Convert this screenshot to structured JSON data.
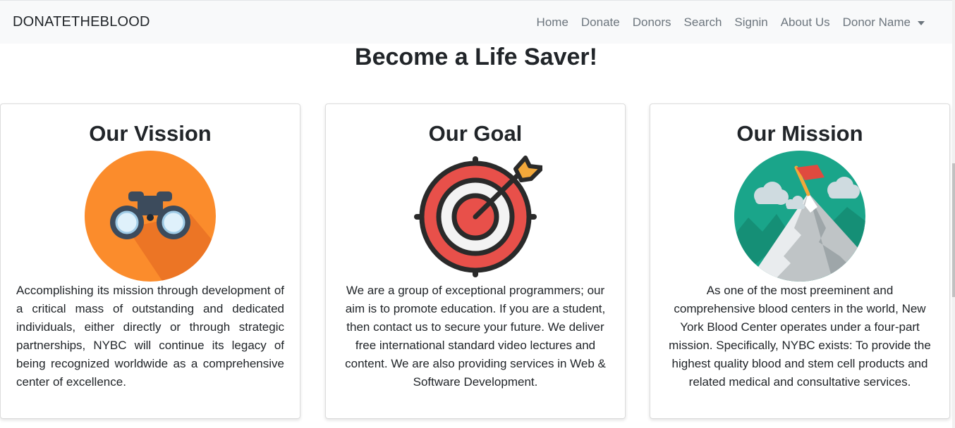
{
  "navbar": {
    "brand": "DONATETHEBLOOD",
    "links": [
      "Home",
      "Donate",
      "Donors",
      "Search",
      "Signin",
      "About Us"
    ],
    "dropdown_label": "Donor Name"
  },
  "page_title": "Become a Life Saver!",
  "cards": [
    {
      "title": "Our Vission",
      "icon": "binoculars-icon",
      "text": "Accomplishing its mission through development of a critical mass of outstanding and dedicated individuals, either directly or through strategic partnerships, NYBC will continue its legacy of being recognized worldwide as a comprehensive center of excellence."
    },
    {
      "title": "Our Goal",
      "icon": "target-icon",
      "text": "We are a group of exceptional programmers; our aim is to promote education. If you are a student, then contact us to secure your future. We deliver free international standard video lectures and content. We are also providing services in Web & Software Development."
    },
    {
      "title": "Our Mission",
      "icon": "mountain-flag-icon",
      "text": "As one of the most preeminent and comprehensive blood centers in the world, New York Blood Center operates under a four-part mission. Specifically, NYBC exists: To provide the highest quality blood and stem cell products and related medical and consultative services."
    }
  ],
  "colors": {
    "navbar_bg": "#f8f9fa",
    "nav_link": "#6c757d",
    "vision_orange": "#fb8c2c",
    "target_red": "#e8504a",
    "mission_teal": "#1aa58a"
  }
}
